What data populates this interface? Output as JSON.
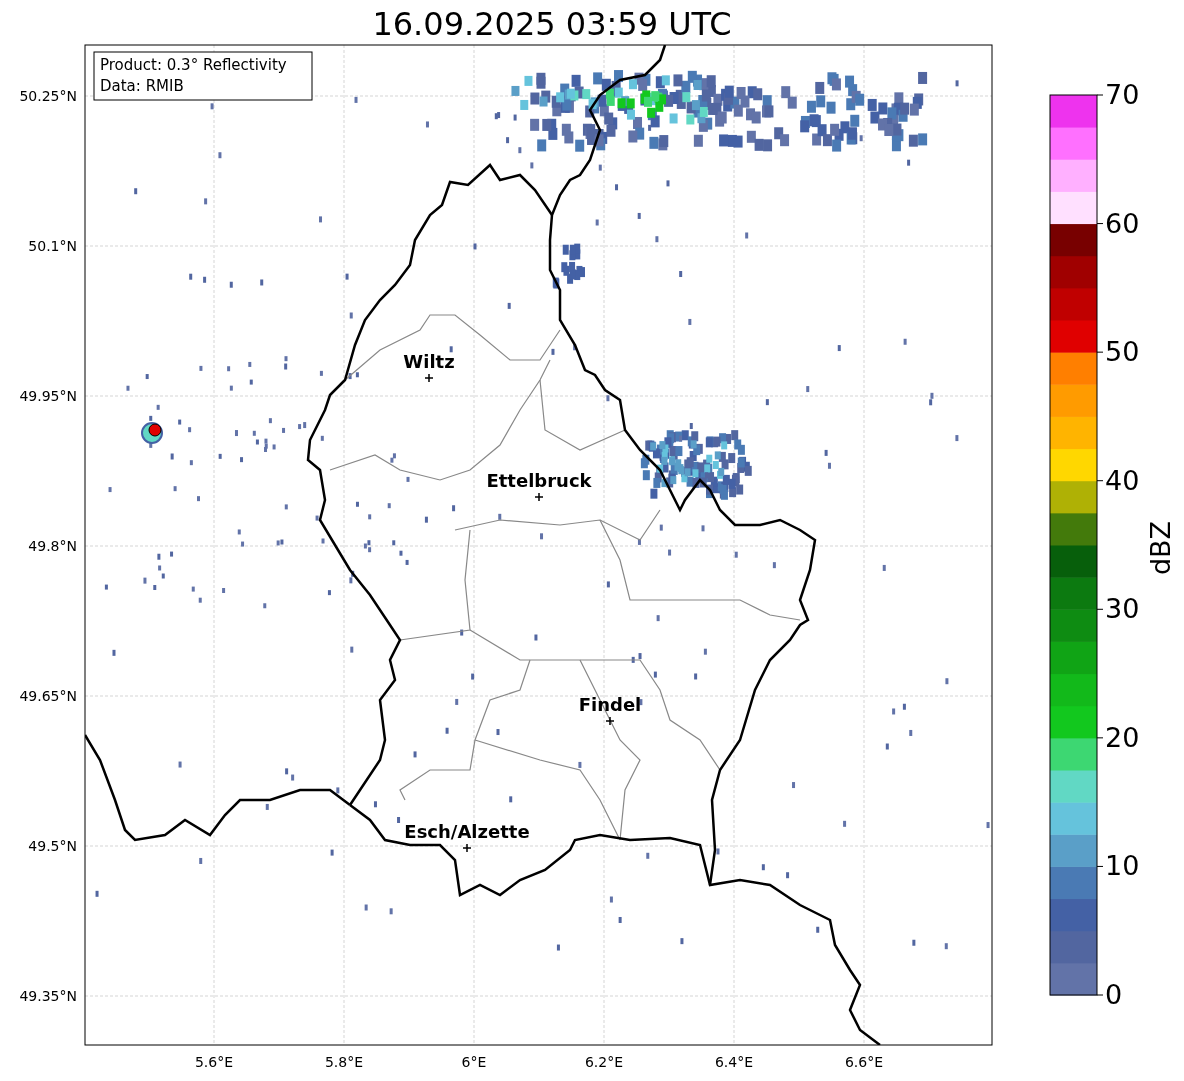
{
  "title": "16.09.2025 03:59 UTC",
  "legend": [
    "Product: 0.3° Reflectivity",
    "Data: RMIB"
  ],
  "y_ticks": [
    "50.25°N",
    "50.1°N",
    "49.95°N",
    "49.8°N",
    "49.65°N",
    "49.5°N",
    "49.35°N"
  ],
  "x_ticks": [
    "5.6°E",
    "5.8°E",
    "6°E",
    "6.2°E",
    "6.4°E",
    "6.6°E"
  ],
  "cities": [
    "Wiltz",
    "Ettelbruck",
    "Findel",
    "Esch/Alzette"
  ],
  "colorbar": {
    "label": "dBZ",
    "ticks": [
      "70",
      "60",
      "50",
      "40",
      "30",
      "20",
      "10",
      "0"
    ],
    "levels": [
      {
        "color": "#6273a8"
      },
      {
        "color": "#5266a0"
      },
      {
        "color": "#4461a5"
      },
      {
        "color": "#4a7ab4"
      },
      {
        "color": "#5a9fc8"
      },
      {
        "color": "#65c3dc"
      },
      {
        "color": "#61d8c4"
      },
      {
        "color": "#3dd772"
      },
      {
        "color": "#12c81e"
      },
      {
        "color": "#12b91a"
      },
      {
        "color": "#10a415"
      },
      {
        "color": "#0e8c12"
      },
      {
        "color": "#0c7a10"
      },
      {
        "color": "#075f0b"
      },
      {
        "color": "#437a0b"
      },
      {
        "color": "#afb105"
      },
      {
        "color": "#ffd700"
      },
      {
        "color": "#ffb400"
      },
      {
        "color": "#ff9b00"
      },
      {
        "color": "#ff7f00"
      },
      {
        "color": "#e00000"
      },
      {
        "color": "#c00000"
      },
      {
        "color": "#a00000"
      },
      {
        "color": "#780000"
      },
      {
        "color": "#ffe0ff"
      },
      {
        "color": "#ffb0ff"
      },
      {
        "color": "#ff70ff"
      },
      {
        "color": "#ee33ee"
      }
    ]
  }
}
